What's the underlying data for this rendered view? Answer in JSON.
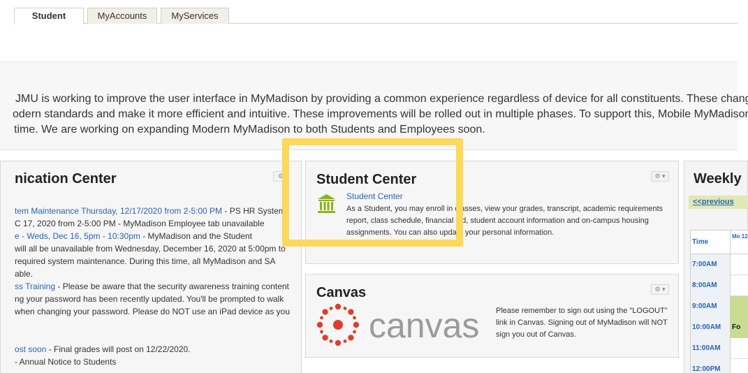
{
  "tabs": [
    {
      "label": "Student"
    },
    {
      "label": "MyAccounts"
    },
    {
      "label": "MyServices"
    }
  ],
  "notice": {
    "line1": "JMU is working to improve the user interface in MyMadison by providing a common experience regardless of device for all constituents. These chang",
    "line2": "odern standards and make it more efficient and intuitive. These improvements will be rolled out in multiple phases. To support this, Mobile MyMadison",
    "line3": "time. We are working on expanding Modern MyMadison to both Students and Employees soon."
  },
  "communication": {
    "title": "nication Center",
    "gear": "⚙",
    "lines": [
      {
        "link": "tem Maintenance Thursday, 12/17/2020 from 2-5:00 PM",
        "text": " - PS HR System"
      },
      {
        "link": "",
        "text": "C 17, 2020 from 2-5:00 PM - MyMadison Employee tab unavailable"
      },
      {
        "link": "e - Weds, Dec 16, 5pm - 10:30pm",
        "text": " - MyMadison and the Student"
      },
      {
        "link": "",
        "text": "will all be unavailable from Wednesday, December 16, 2020 at 5:00pm to"
      },
      {
        "link": "",
        "text": "required system maintenance. During this time, all MyMadison and SA"
      },
      {
        "link": "",
        "text": "able."
      },
      {
        "link": "ss Training",
        "text": " - Please be aware that the security awareness training content"
      },
      {
        "link": "",
        "text": "ng your password has been recently updated. You'll be prompted to walk"
      },
      {
        "link": "",
        "text": "when changing your password. Please do NOT use an iPad device as you"
      },
      {
        "link": "",
        "text": ""
      },
      {
        "link": "",
        "text": ""
      },
      {
        "link": "ost soon",
        "text": " - Final grades will post on 12/22/2020."
      },
      {
        "link": "",
        "text": "- Annual Notice to Students"
      }
    ]
  },
  "student_center": {
    "title": "Student Center",
    "gear": "⚙ ▾",
    "link": "Student Center",
    "description": "As a Student, you may enroll in classes, view your grades, transcript, academic requirements report, class schedule, financial aid, student account information and on-campus housing assignments. You can also update your personal information."
  },
  "canvas": {
    "title": "Canvas",
    "gear": "⚙ ▾",
    "logo_text": "canvas",
    "message": "Please remember to sign out using the \"LOGOUT\" link in Canvas. Signing out of MyMadison will NOT sign you out of Canvas."
  },
  "weekly": {
    "title": "Weekly",
    "prev": "<<previous",
    "time_header": "Time",
    "day_header": "Mo 12",
    "times": [
      "7:00AM",
      "8:00AM",
      "9:00AM",
      "10:00AM",
      "11:00AM",
      "12:00PM"
    ],
    "event_label": "Fo"
  },
  "colors": {
    "highlight": "#fcd95a",
    "link": "#2a63b6",
    "canvas_red": "#e03e2d",
    "event_green": "#c9dc8f",
    "icon_green": "#8cb314"
  }
}
